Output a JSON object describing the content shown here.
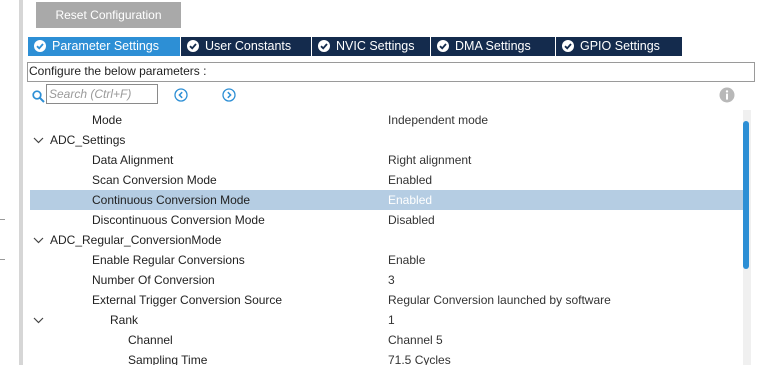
{
  "reset_button": {
    "label": "Reset Configuration"
  },
  "tabs": [
    {
      "label": "Parameter Settings",
      "active": true
    },
    {
      "label": "User Constants",
      "active": false
    },
    {
      "label": "NVIC Settings",
      "active": false
    },
    {
      "label": "DMA Settings",
      "active": false
    },
    {
      "label": "GPIO Settings",
      "active": false
    }
  ],
  "description": "Configure the below parameters :",
  "search": {
    "placeholder": "Search (Ctrl+F)",
    "value": ""
  },
  "icons": {
    "search": "search-icon",
    "previous": "chevron-left-circle-icon",
    "next": "chevron-right-circle-icon",
    "info": "info-icon",
    "tab_check": "check-circle-icon",
    "expand": "chevron-down-icon"
  },
  "colors": {
    "accent": "#2d8fd5",
    "tab_inactive": "#142b4d",
    "selection": "#b5cde3",
    "button_gray": "#a9a9a9"
  },
  "tree": [
    {
      "name": "Mode",
      "value": "Independent mode",
      "level": 1,
      "expandable": false,
      "selected": false
    },
    {
      "name": "ADC_Settings",
      "value": "",
      "level": 0,
      "expandable": true,
      "selected": false
    },
    {
      "name": "Data Alignment",
      "value": "Right alignment",
      "level": 1,
      "expandable": false,
      "selected": false
    },
    {
      "name": "Scan Conversion Mode",
      "value": "Enabled",
      "level": 1,
      "expandable": false,
      "selected": false
    },
    {
      "name": "Continuous Conversion Mode",
      "value": "Enabled",
      "level": 1,
      "expandable": false,
      "selected": true
    },
    {
      "name": "Discontinuous Conversion Mode",
      "value": "Disabled",
      "level": 1,
      "expandable": false,
      "selected": false
    },
    {
      "name": "ADC_Regular_ConversionMode",
      "value": "",
      "level": 0,
      "expandable": true,
      "selected": false
    },
    {
      "name": "Enable Regular Conversions",
      "value": "Enable",
      "level": 1,
      "expandable": false,
      "selected": false
    },
    {
      "name": "Number Of Conversion",
      "value": "3",
      "level": 1,
      "expandable": false,
      "selected": false
    },
    {
      "name": "External Trigger Conversion Source",
      "value": "Regular Conversion launched by software",
      "level": 1,
      "expandable": false,
      "selected": false
    },
    {
      "name": "Rank",
      "value": "1",
      "level": 2,
      "expandable": true,
      "selected": false
    },
    {
      "name": "Channel",
      "value": "Channel 5",
      "level": 3,
      "expandable": false,
      "selected": false
    },
    {
      "name": "Sampling Time",
      "value": "71.5 Cycles",
      "level": 3,
      "expandable": false,
      "selected": false
    }
  ]
}
